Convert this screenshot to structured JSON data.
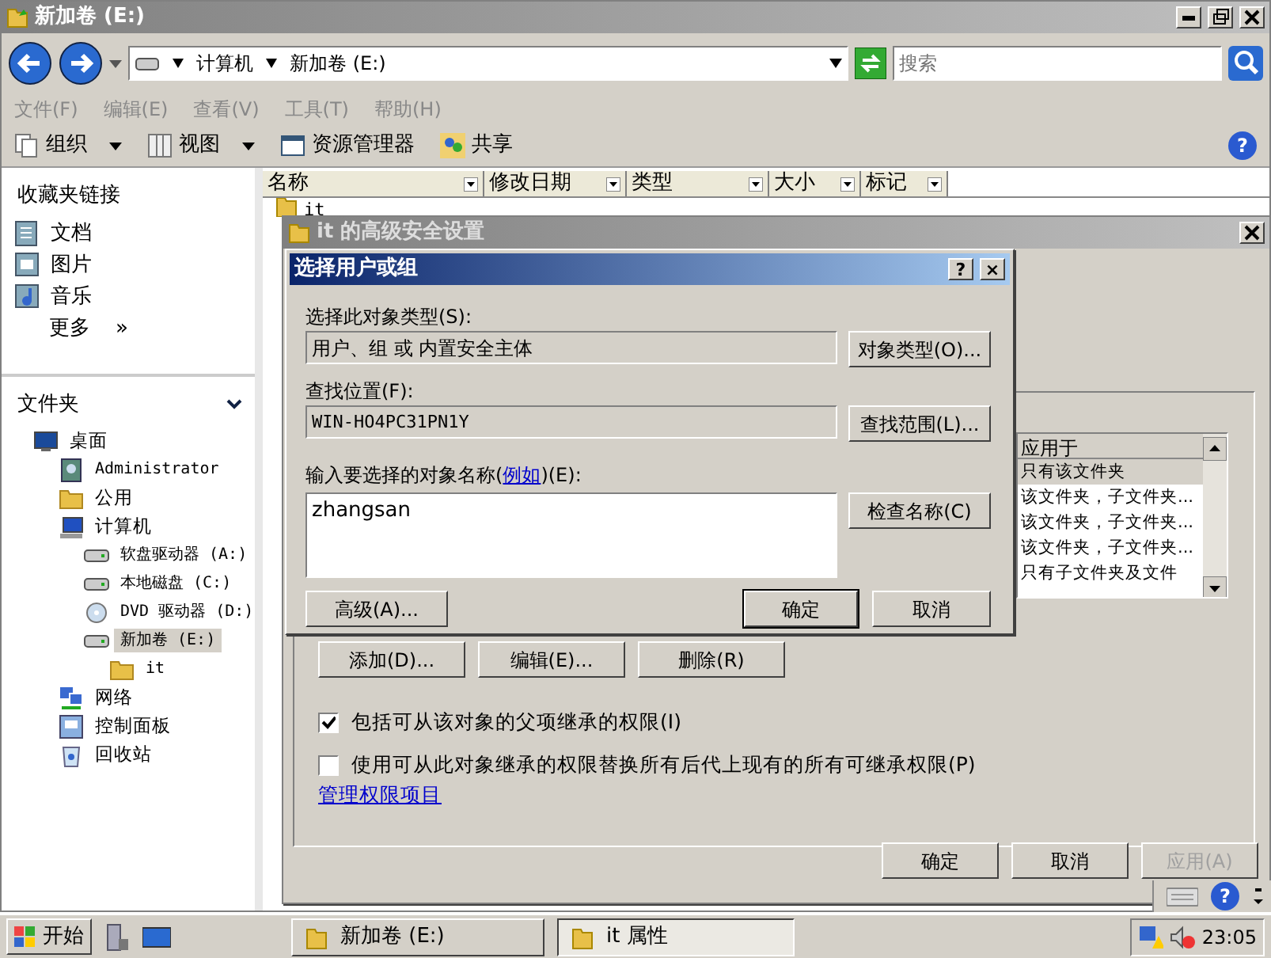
{
  "explorer": {
    "title": "新加卷 (E:)",
    "breadcrumb": [
      "计算机",
      "新加卷 (E:)"
    ],
    "search": {
      "placeholder": "搜索"
    },
    "help_glyph": "?",
    "menu": [
      "文件(F)",
      "编辑(E)",
      "查看(V)",
      "工具(T)",
      "帮助(H)"
    ],
    "toolbar": [
      {
        "label": "组织",
        "dropdown": true
      },
      {
        "label": "视图",
        "dropdown": true
      },
      {
        "label": "资源管理器",
        "dropdown": false
      },
      {
        "label": "共享",
        "dropdown": false
      }
    ],
    "favorites": {
      "title": "收藏夹链接",
      "items": [
        "文档",
        "图片",
        "音乐"
      ],
      "more": "更多",
      "more_glyph": "»"
    },
    "folders": {
      "title": "文件夹",
      "tree": [
        {
          "label": "桌面",
          "kind": "desktop",
          "selected": false,
          "children": [
            {
              "label": "Administrator",
              "kind": "user",
              "selected": false
            },
            {
              "label": "公用",
              "kind": "folder",
              "selected": false
            },
            {
              "label": "计算机",
              "kind": "computer",
              "selected": false,
              "children": [
                {
                  "label": "软盘驱动器 (A:)",
                  "kind": "drive",
                  "selected": false
                },
                {
                  "label": "本地磁盘 (C:)",
                  "kind": "drive",
                  "selected": false
                },
                {
                  "label": "DVD 驱动器 (D:)",
                  "kind": "disc",
                  "selected": false
                },
                {
                  "label": "新加卷 (E:)",
                  "kind": "drive",
                  "selected": true,
                  "children": [
                    {
                      "label": "it",
                      "kind": "folder",
                      "selected": false
                    }
                  ]
                }
              ]
            },
            {
              "label": "网络",
              "kind": "network",
              "selected": false
            },
            {
              "label": "控制面板",
              "kind": "panel",
              "selected": false
            },
            {
              "label": "回收站",
              "kind": "bin",
              "selected": false
            }
          ]
        }
      ]
    },
    "columns": [
      "名称",
      "修改日期",
      "类型",
      "大小",
      "标记"
    ],
    "rows": [
      {
        "name": "it"
      }
    ]
  },
  "security": {
    "title": "it 的高级安全设置",
    "list_header": "应用于",
    "list_rows": [
      {
        "text": "只有该文件夹",
        "selected": true
      },
      {
        "text": "该文件夹，子文件夹...",
        "selected": false
      },
      {
        "text": "该文件夹，子文件夹...",
        "selected": false
      },
      {
        "text": "该文件夹，子文件夹...",
        "selected": false
      },
      {
        "text": "只有子文件夹及文件",
        "selected": false
      }
    ],
    "buttons": [
      "添加(D)...",
      "编辑(E)...",
      "删除(R)"
    ],
    "checkboxes": [
      {
        "label": "包括可从该对象的父项继承的权限(I)",
        "checked": true
      },
      {
        "label": "使用可从此对象继承的权限替换所有后代上现有的所有可继承权限(P)",
        "checked": false
      }
    ],
    "link": "管理权限项目",
    "footer": [
      {
        "label": "确定",
        "disabled": false
      },
      {
        "label": "取消",
        "disabled": false
      },
      {
        "label": "应用(A)",
        "disabled": true
      }
    ]
  },
  "select": {
    "title": "选择用户或组",
    "help": "?",
    "close": "×",
    "type_label": "选择此对象类型(S):",
    "type_value": "用户、组 或 内置安全主体",
    "type_button": "对象类型(O)...",
    "location_label": "查找位置(F):",
    "location_value": "WIN-HO4PC31PN1Y",
    "location_button": "查找范围(L)...",
    "name_label": {
      "before": "输入要选择的对象名称(",
      "link": "例如",
      "after": ")(E):"
    },
    "name_value": "zhangsan",
    "check_button": "检查名称(C)",
    "advanced_button": "高级(A)...",
    "ok_button": "确定",
    "cancel_button": "取消"
  },
  "taskbar": {
    "start": "开始",
    "tasks": [
      {
        "label": "新加卷 (E:)",
        "selected": false
      },
      {
        "label": "it 属性",
        "selected": true
      }
    ],
    "clock": "23:05",
    "help_glyph": "?"
  }
}
